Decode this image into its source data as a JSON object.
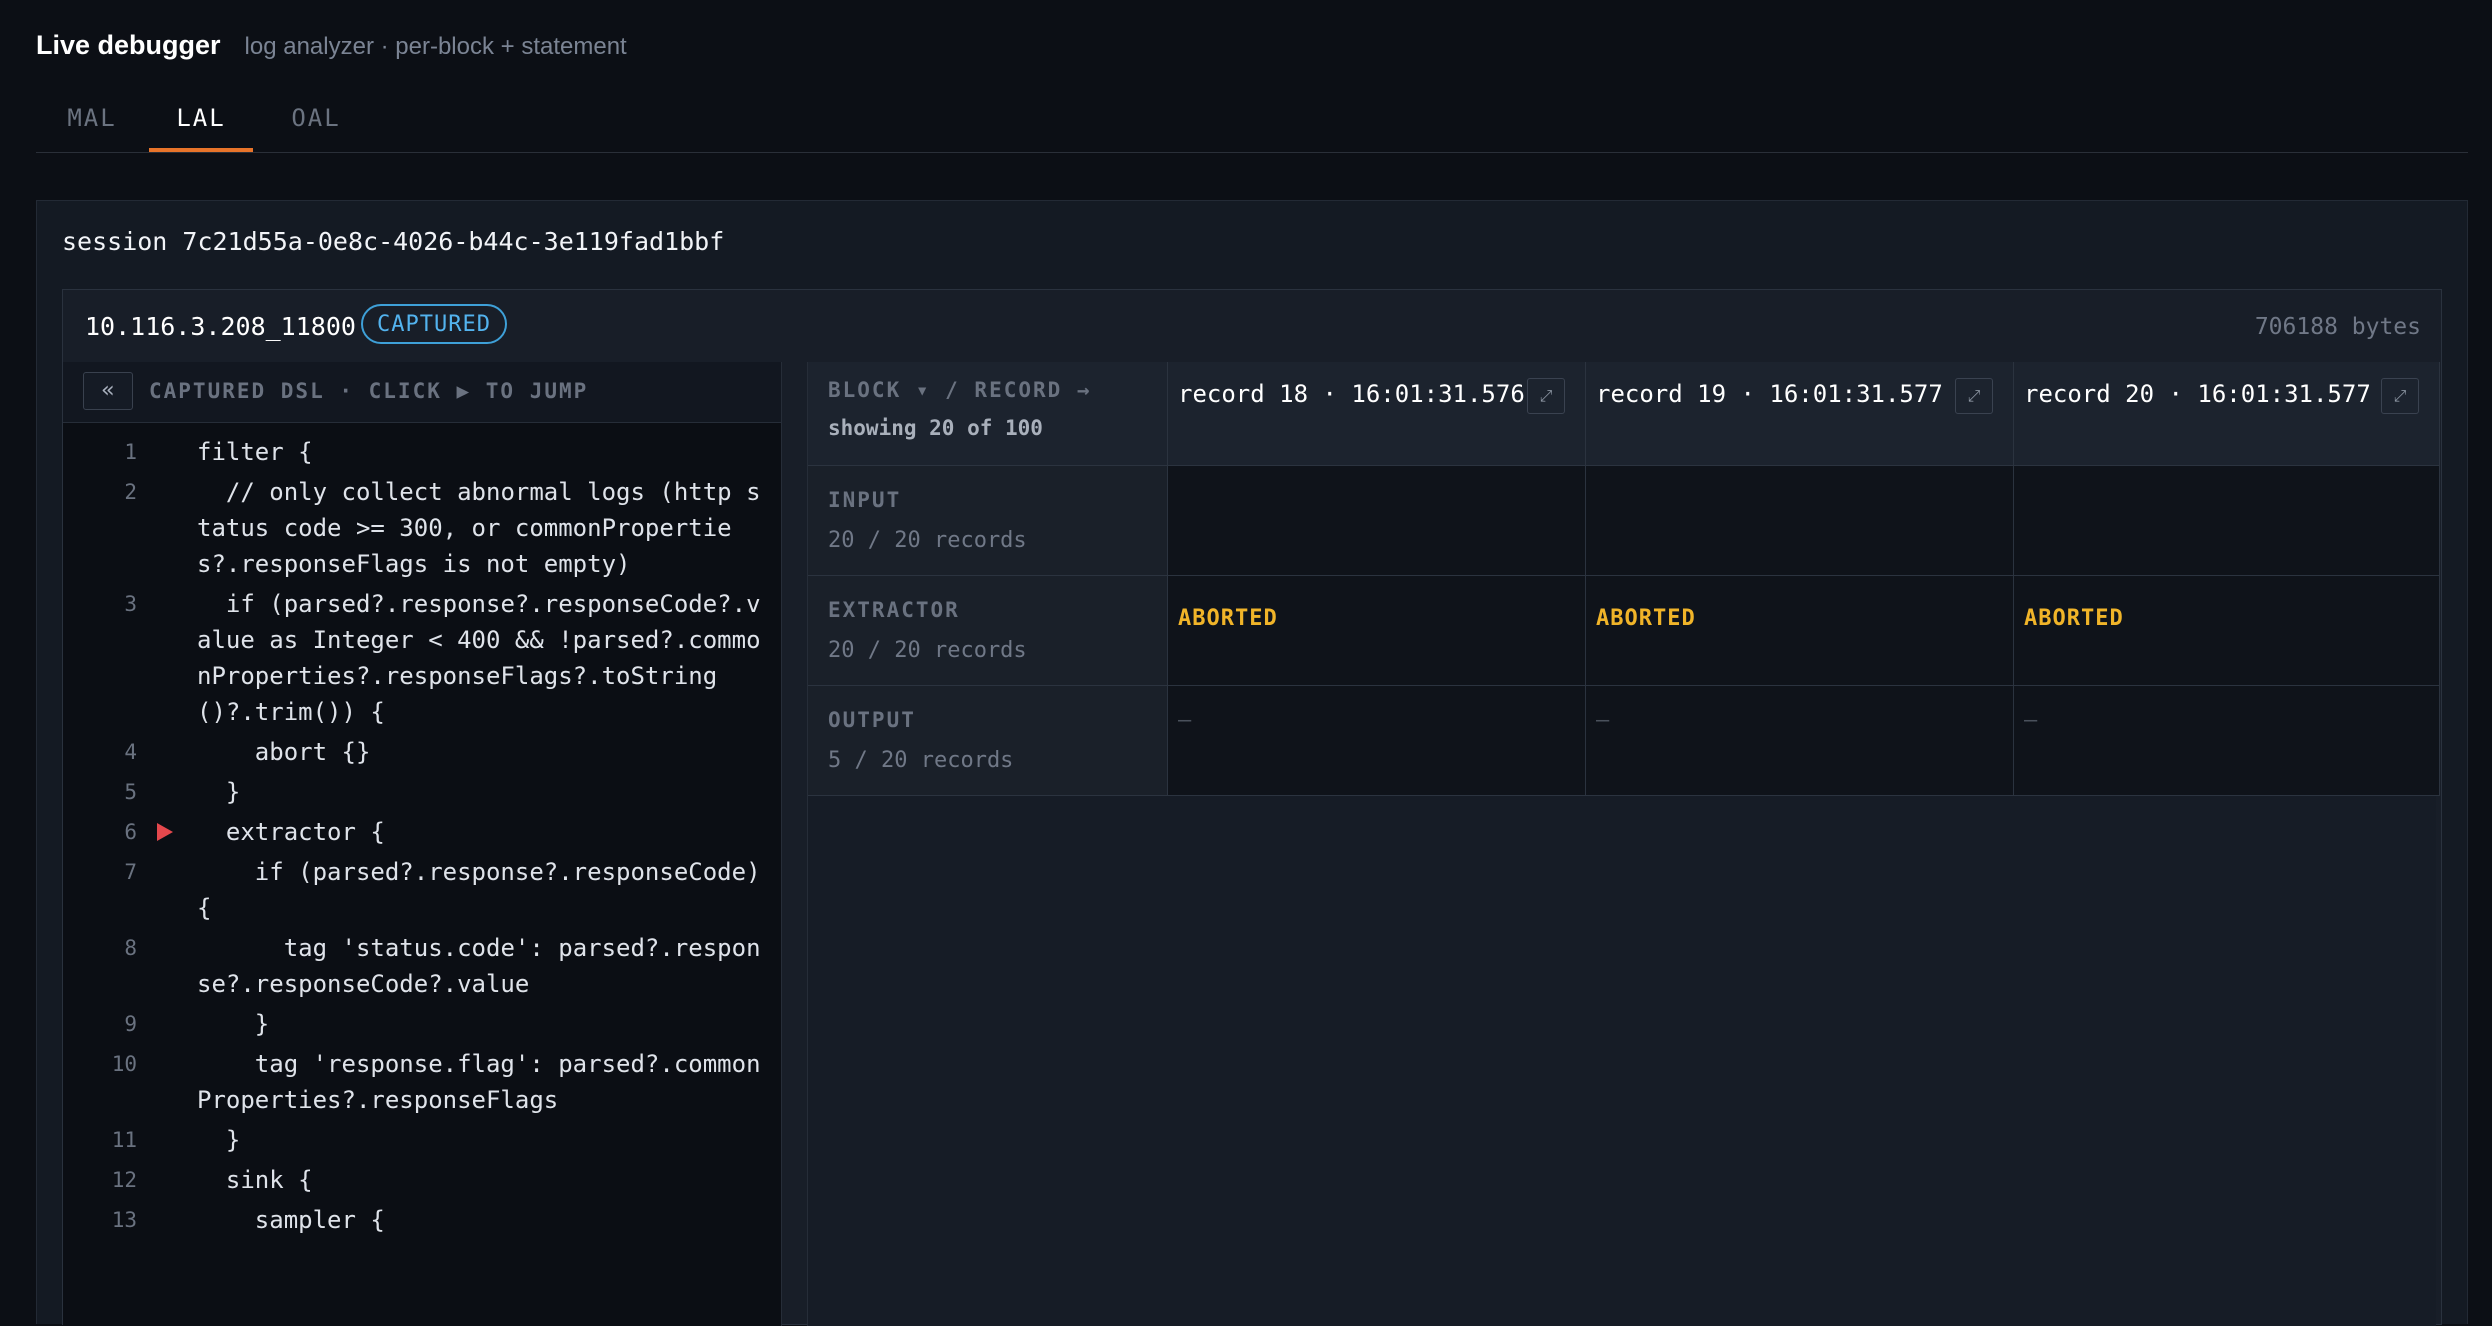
{
  "header": {
    "title": "Live debugger",
    "subtitle": "log analyzer · per-block + statement"
  },
  "tabs": [
    {
      "label": "MAL",
      "active": false
    },
    {
      "label": "LAL",
      "active": true
    },
    {
      "label": "OAL",
      "active": false
    }
  ],
  "session": {
    "label": "session 7c21d55a-0e8c-4026-b44c-3e119fad1bbf"
  },
  "capture": {
    "address": "10.116.3.208_11800",
    "status": "CAPTURED",
    "size": "706188 bytes"
  },
  "dsl": {
    "collapse_label": "«",
    "title": "CAPTURED DSL · CLICK ▶ TO JUMP",
    "lines": [
      {
        "n": "1",
        "text": "filter {"
      },
      {
        "n": "2",
        "text": "  // only collect abnormal logs (http status code >= 300, or commonProperties?.responseFlags is not empty)"
      },
      {
        "n": "3",
        "text": "  if (parsed?.response?.responseCode?.value as Integer < 400 && !parsed?.commonProperties?.responseFlags?.toString()?.trim()) {"
      },
      {
        "n": "4",
        "text": "    abort {}"
      },
      {
        "n": "5",
        "text": "  }"
      },
      {
        "n": "6",
        "text": "  extractor {",
        "marker": true
      },
      {
        "n": "7",
        "text": "    if (parsed?.response?.responseCode) {"
      },
      {
        "n": "8",
        "text": "      tag 'status.code': parsed?.response?.responseCode?.value"
      },
      {
        "n": "9",
        "text": "    }"
      },
      {
        "n": "10",
        "text": "    tag 'response.flag': parsed?.commonProperties?.responseFlags"
      },
      {
        "n": "11",
        "text": "  }"
      },
      {
        "n": "12",
        "text": "  sink {"
      },
      {
        "n": "13",
        "text": "    sampler {"
      }
    ]
  },
  "grid": {
    "corner_label": "BLOCK ▾ / RECORD →",
    "showing": "showing 20 of 100",
    "records": [
      {
        "title": "record 18 · 16:01:31.576",
        "expand": "⤢"
      },
      {
        "title": "record 19 · 16:01:31.577",
        "expand": "⤢"
      },
      {
        "title": "record 20 · 16:01:31.577",
        "expand": "⤢"
      }
    ],
    "rows": [
      {
        "name": "INPUT",
        "count": "20 / 20 records",
        "cells": [
          "",
          "",
          ""
        ]
      },
      {
        "name": "EXTRACTOR",
        "count": "20 / 20 records",
        "cells": [
          "ABORTED",
          "ABORTED",
          "ABORTED"
        ]
      },
      {
        "name": "OUTPUT",
        "count": "5 / 20 records",
        "cells": [
          "—",
          "—",
          "—"
        ]
      }
    ]
  },
  "colors": {
    "accent": "#e8742a",
    "badge": "#3ea0d8",
    "aborted": "#f0b429",
    "marker": "#e5484d"
  }
}
